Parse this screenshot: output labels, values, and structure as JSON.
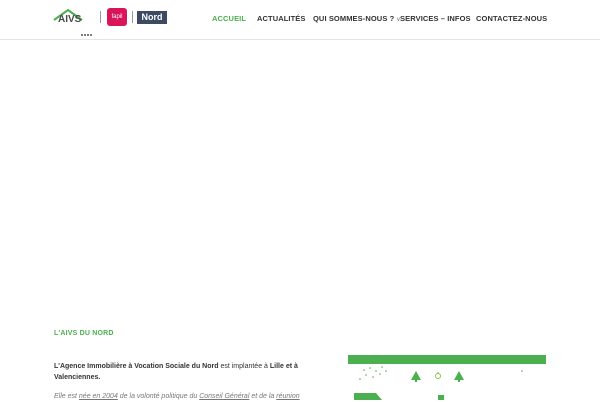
{
  "logo": {
    "aivs_text": "AIVS",
    "fapil_text": "fapil",
    "nord_text": "Nord"
  },
  "nav": {
    "items": [
      {
        "label": "ACCUEIL",
        "active": true
      },
      {
        "label": "ACTUALITÉS",
        "active": false
      },
      {
        "label": "QUI SOMMES-NOUS ?",
        "active": false,
        "has_dropdown": true
      },
      {
        "label": "SERVICES – INFOS",
        "active": false
      },
      {
        "label": "CONTACTEZ-NOUS",
        "active": false
      }
    ],
    "chevron_icon": "chevron-down-icon"
  },
  "section": {
    "title": "L'AIVS DU NORD",
    "p1_part1": "L'Agence Immobilière à Vocation Sociale du Nord",
    "p1_part2": " est implantée à ",
    "p1_part3": "Lille et à Valenciennes.",
    "p2_part1": "Elle est ",
    "p2_part2": "née en 2004",
    "p2_part3": " de la volonté politique du ",
    "p2_part4": "Conseil Général",
    "p2_part5": " et de la ",
    "p2_part6": "réunion"
  },
  "colors": {
    "accent": "#4caf50",
    "fapil": "#d8145b",
    "nord": "#3c4b61"
  }
}
